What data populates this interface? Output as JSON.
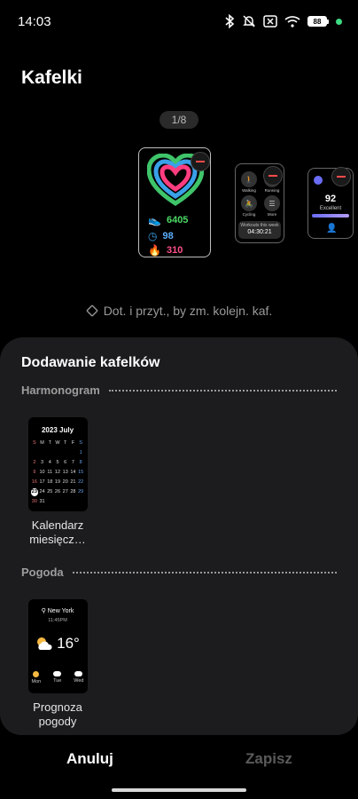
{
  "status": {
    "time": "14:03",
    "battery": "88",
    "icons": [
      "bluetooth-icon",
      "silent-icon",
      "dnd-icon",
      "wifi-icon",
      "battery-icon"
    ]
  },
  "header": {
    "title": "Kafelki",
    "pager": "1/8"
  },
  "carousel": {
    "activity": {
      "steps": "6405",
      "minutes": "98",
      "calories": "310"
    },
    "workout": {
      "items": [
        "Walking",
        "Running",
        "Cycling",
        "More"
      ],
      "footer_label": "Workouts this week",
      "footer_time": "04:30:21"
    },
    "sleep": {
      "score": "92",
      "status": "Excellent"
    }
  },
  "hint": "Dot. i przyt., by zm. kolejn. kaf.",
  "sheet": {
    "title": "Dodawanie kafelków",
    "sections": [
      {
        "header": "Harmonogram",
        "tile": {
          "label": "Kalendarz miesięcz…",
          "cal_title": "2023 July",
          "weekdays": [
            "S",
            "M",
            "T",
            "W",
            "T",
            "F",
            "S"
          ]
        }
      },
      {
        "header": "Pogoda",
        "tile": {
          "label": "Prognoza pogody",
          "city": "New York",
          "time": "11:45PM",
          "temp": "16°",
          "days": [
            "Mon",
            "Tue",
            "Wed"
          ]
        }
      }
    ]
  },
  "actions": {
    "cancel": "Anuluj",
    "save": "Zapisz"
  },
  "colors": {
    "accent_green": "#3ddc84",
    "save_disabled": "#5a5a5a",
    "sheet_bg": "#1c1c1e"
  }
}
